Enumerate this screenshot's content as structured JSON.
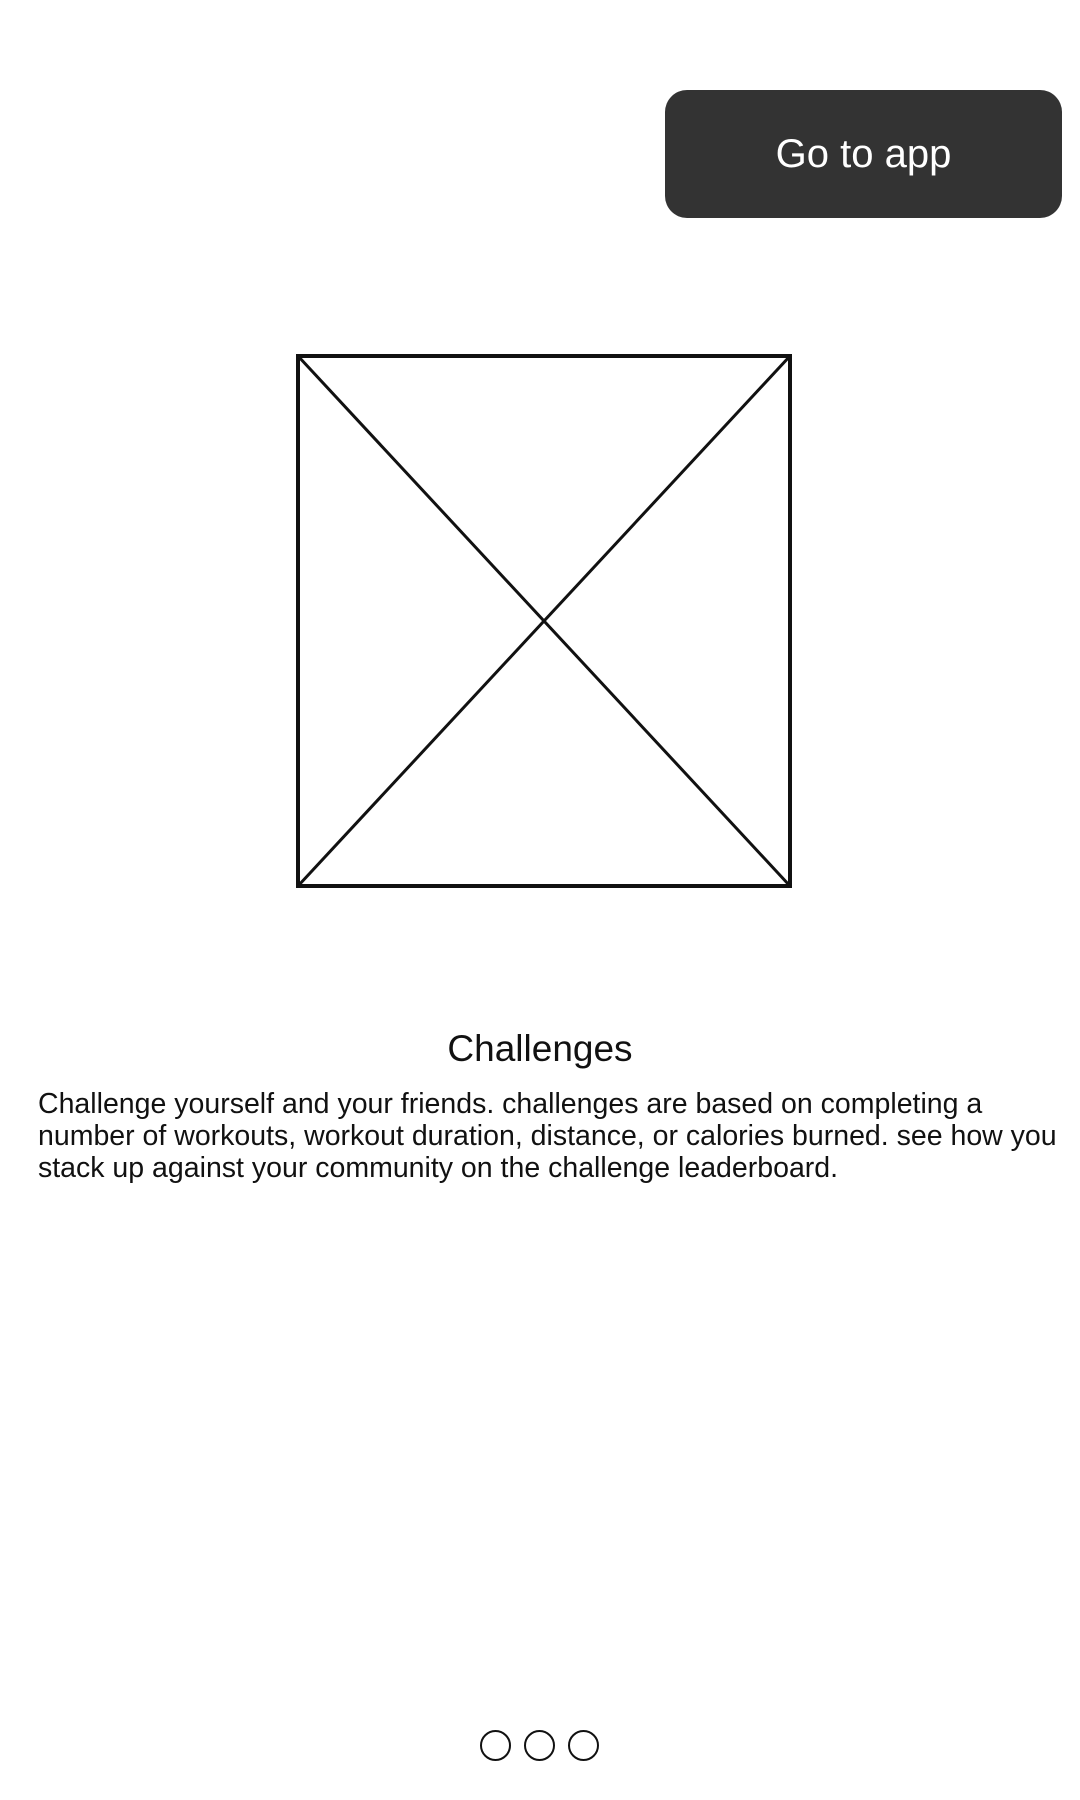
{
  "header": {
    "go_to_app_label": "Go to app"
  },
  "hero": {
    "image_icon": "image-placeholder-icon"
  },
  "content": {
    "title": "Challenges",
    "description": "Challenge yourself and your friends. challenges are based on completing a number of workouts, workout duration, distance, or calories burned. see how you stack up against your community on the challenge leaderboard."
  },
  "pager": {
    "page_count": 3
  },
  "colors": {
    "button_bg": "#333333",
    "button_text": "#ffffff",
    "text": "#111111",
    "background": "#ffffff"
  }
}
